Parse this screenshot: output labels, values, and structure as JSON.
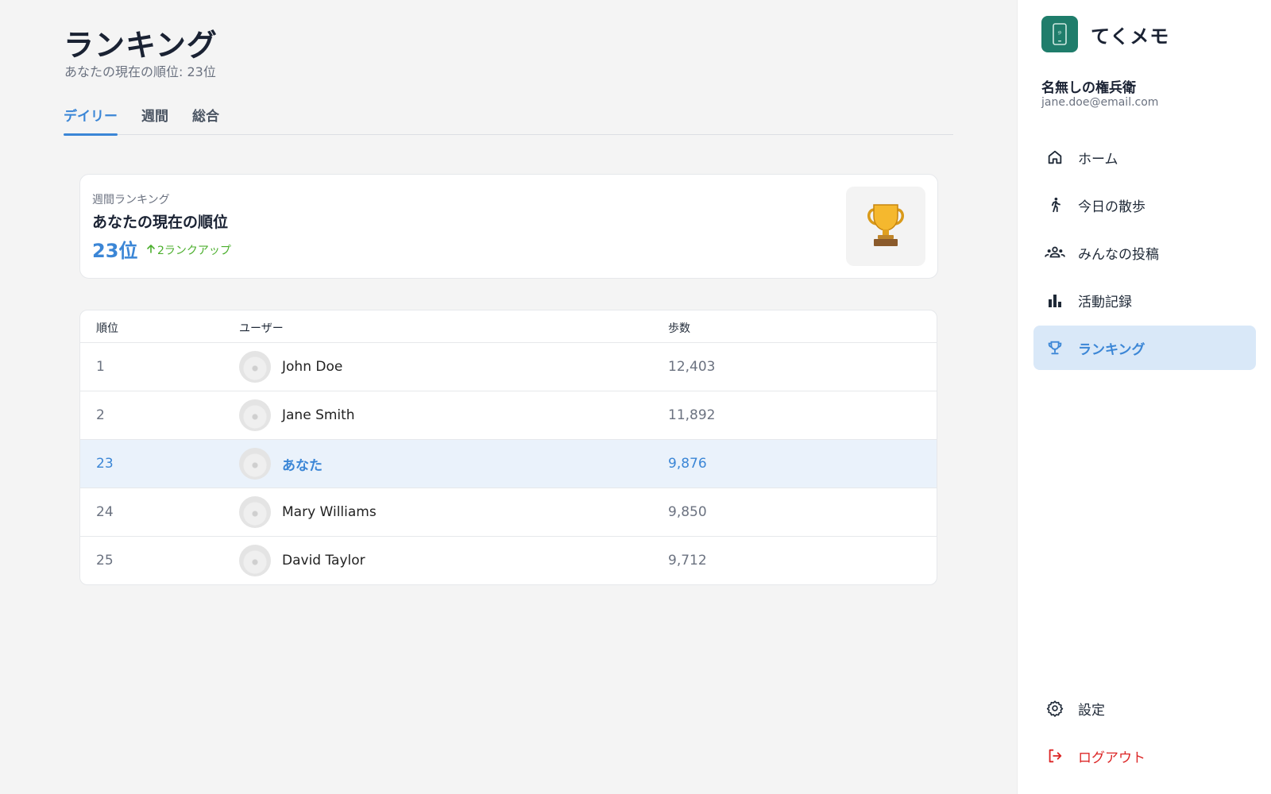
{
  "page": {
    "title": "ランキング",
    "subtitle": "あなたの現在の順位: 23位"
  },
  "tabs": [
    {
      "label": "デイリー",
      "active": true
    },
    {
      "label": "週間",
      "active": false
    },
    {
      "label": "総合",
      "active": false
    }
  ],
  "rank_card": {
    "label": "週間ランキング",
    "heading": "あなたの現在の順位",
    "rank": "23位",
    "change": "2ランクアップ",
    "change_icon": "arrow-up-icon",
    "trophy_icon": "trophy-icon"
  },
  "table": {
    "headers": {
      "rank": "順位",
      "user": "ユーザー",
      "steps": "歩数"
    },
    "rows": [
      {
        "rank": "1",
        "name": "John Doe",
        "steps": "12,403",
        "me": false
      },
      {
        "rank": "2",
        "name": "Jane Smith",
        "steps": "11,892",
        "me": false
      },
      {
        "rank": "23",
        "name": "あなた",
        "steps": "9,876",
        "me": true
      },
      {
        "rank": "24",
        "name": "Mary Williams",
        "steps": "9,850",
        "me": false
      },
      {
        "rank": "25",
        "name": "David Taylor",
        "steps": "9,712",
        "me": false
      }
    ]
  },
  "sidebar": {
    "brand": "てくメモ",
    "profile_name": "名無しの権兵衛",
    "profile_email": "jane.doe@email.com",
    "nav": [
      {
        "label": "ホーム",
        "icon": "home-icon",
        "active": false
      },
      {
        "label": "今日の散歩",
        "icon": "walking-icon",
        "active": false
      },
      {
        "label": "みんなの投稿",
        "icon": "group-icon",
        "active": false
      },
      {
        "label": "活動記録",
        "icon": "bar-chart-icon",
        "active": false
      },
      {
        "label": "ランキング",
        "icon": "trophy-icon",
        "active": true
      }
    ],
    "settings_label": "設定",
    "logout_label": "ログアウト"
  },
  "colors": {
    "accent": "#3b86d6",
    "brand": "#1f7d6b",
    "up": "#4caf2e",
    "danger": "#dc2626"
  }
}
